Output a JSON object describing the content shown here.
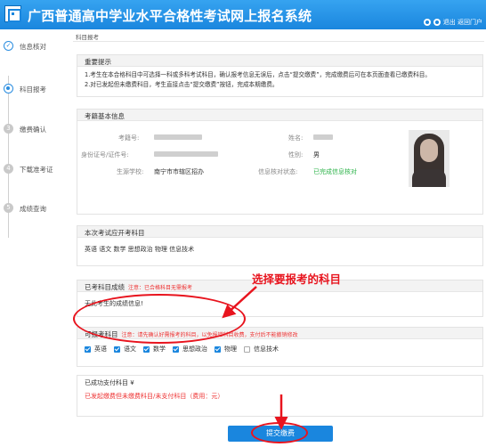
{
  "header": {
    "title": "广西普通高中学业水平合格性考试网上报名系统",
    "user_links": "退出 返回门户"
  },
  "sidebar": {
    "steps": [
      {
        "num": "✓",
        "label": "信息核对",
        "state": "done"
      },
      {
        "num": "",
        "label": "科目报考",
        "state": "current"
      },
      {
        "num": "3",
        "label": "缴费确认",
        "state": "todo"
      },
      {
        "num": "4",
        "label": "下载准考证",
        "state": "todo"
      },
      {
        "num": "5",
        "label": "成绩查询",
        "state": "todo"
      }
    ]
  },
  "main": {
    "breadcrumb": "科目报考",
    "notice": {
      "title": "重要提示",
      "line1": "1.考生在本合格科目中可选择一科或多科考试科目，确认报考信息无误后，点击“提交缴费”，完成缴费后可在本页面查看已缴费科目。",
      "line2": "2.对已发起但未缴费科目，考生直接点击“提交缴费”按钮，完成本期缴费。"
    },
    "basic": {
      "title": "考籍基本信息",
      "exam_no_label": "考籍号:",
      "name_label": "姓名:",
      "id_label": "身份证号/证件号:",
      "gender_label": "性别:",
      "gender_value": "男",
      "school_label": "生源学校:",
      "school_value": "南宁市市辖区招办",
      "check_label": "信息核对状态:",
      "check_value": "已完成信息核对"
    },
    "open_subjects": {
      "title": "本次考试应开考科目",
      "value": "英语 语文 数学 思想政治 物理 信息技术"
    },
    "passed": {
      "title": "已考科目成绩",
      "note": "注意：已合格科目无需报考",
      "value": "无此考生的成绩信息!"
    },
    "optional": {
      "title": "可报考科目",
      "note": "注意：请先确认好需报考的科目，以免报错科目收费，支付后不能撤销修改",
      "subjects": [
        {
          "label": "英语",
          "checked": true
        },
        {
          "label": "语文",
          "checked": true
        },
        {
          "label": "数学",
          "checked": true
        },
        {
          "label": "思想政治",
          "checked": true
        },
        {
          "label": "物理",
          "checked": true
        },
        {
          "label": "信息技术",
          "checked": false
        }
      ]
    },
    "paid": {
      "title": "已成功支付科目 ¥"
    },
    "unpaid": {
      "title": "已发起缴费但未缴费科目/未支付科目（费用：元）"
    },
    "submit_label": "提交缴费"
  },
  "annotation": {
    "text": "选择要报考的科目",
    "color": "#e8141e"
  }
}
